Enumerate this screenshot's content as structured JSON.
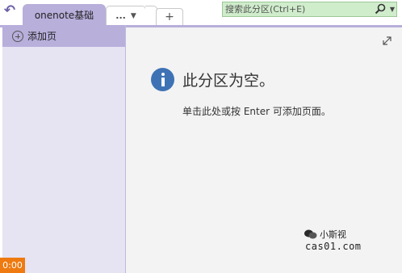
{
  "tabs": {
    "active_label": "onenote基础",
    "more_label": "...",
    "add_label": "+"
  },
  "search": {
    "placeholder": "搜索此分区(Ctrl+E)"
  },
  "sidebar": {
    "add_page_label": "添加页"
  },
  "content": {
    "title": "此分区为空。",
    "hint": "单击此处或按 Enter 可添加页面。"
  },
  "watermark": {
    "name": "小斯视",
    "url": "cas01.com"
  },
  "timer": {
    "value": "0:00"
  },
  "colors": {
    "accent": "#b8afdb",
    "panel": "#e6e3f3",
    "search": "#cfeccb",
    "info": "#3e72b5",
    "timer": "#ee7a10"
  },
  "icons": [
    "back-icon",
    "search-icon",
    "expand-icon",
    "info-icon",
    "add-circle-icon"
  ]
}
